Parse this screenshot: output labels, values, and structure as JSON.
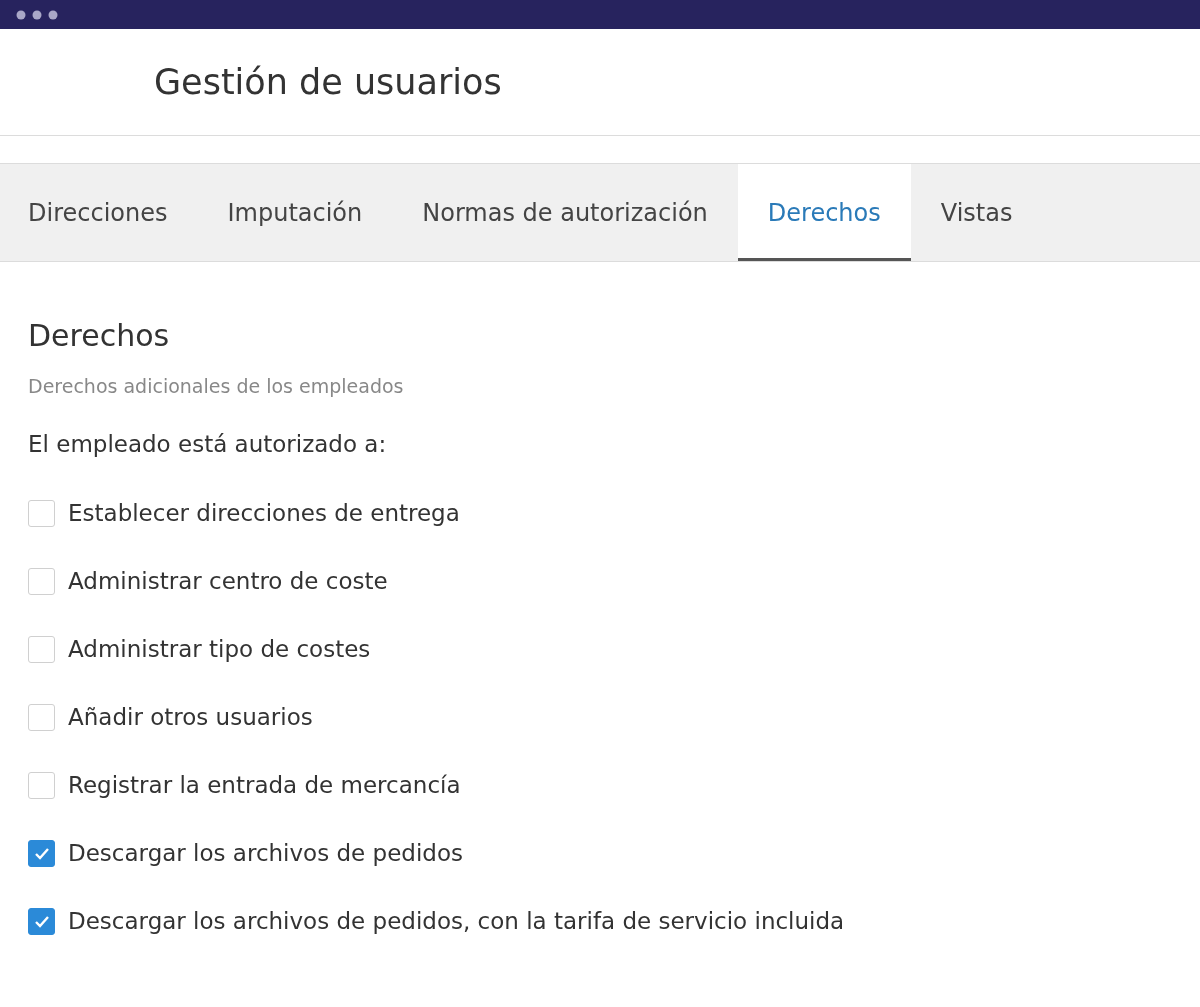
{
  "window": {
    "title": "Gestión de usuarios"
  },
  "tabs": [
    {
      "label": "Direcciones",
      "selected": false
    },
    {
      "label": "Imputación",
      "selected": false
    },
    {
      "label": "Normas de autorización",
      "selected": false
    },
    {
      "label": "Derechos",
      "selected": true
    },
    {
      "label": "Vistas",
      "selected": false
    }
  ],
  "section": {
    "heading": "Derechos",
    "subtitle": "Derechos adicionales de los empleados",
    "intro": "El empleado está autorizado a:"
  },
  "rights": [
    {
      "label": "Establecer direcciones de entrega",
      "checked": false
    },
    {
      "label": "Administrar centro de coste",
      "checked": false
    },
    {
      "label": "Administrar tipo de costes",
      "checked": false
    },
    {
      "label": "Añadir otros usuarios",
      "checked": false
    },
    {
      "label": "Registrar la entrada de mercancía",
      "checked": false
    },
    {
      "label": "Descargar los archivos de pedidos",
      "checked": true
    },
    {
      "label": "Descargar los archivos de pedidos, con la tarifa de servicio incluida",
      "checked": true
    }
  ]
}
